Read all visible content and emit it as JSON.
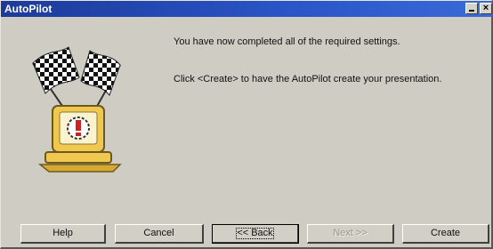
{
  "window": {
    "title": "AutoPilot"
  },
  "content": {
    "message_complete": "You have now completed all of the required settings.",
    "message_create": "Click <Create> to have the  AutoPilot create your presentation."
  },
  "buttons": {
    "help": "Help",
    "cancel": "Cancel",
    "back": "<< Back",
    "next": "Next >>",
    "create": "Create"
  },
  "icons": {
    "illustration": "checkered-flags-computer-illustration"
  }
}
